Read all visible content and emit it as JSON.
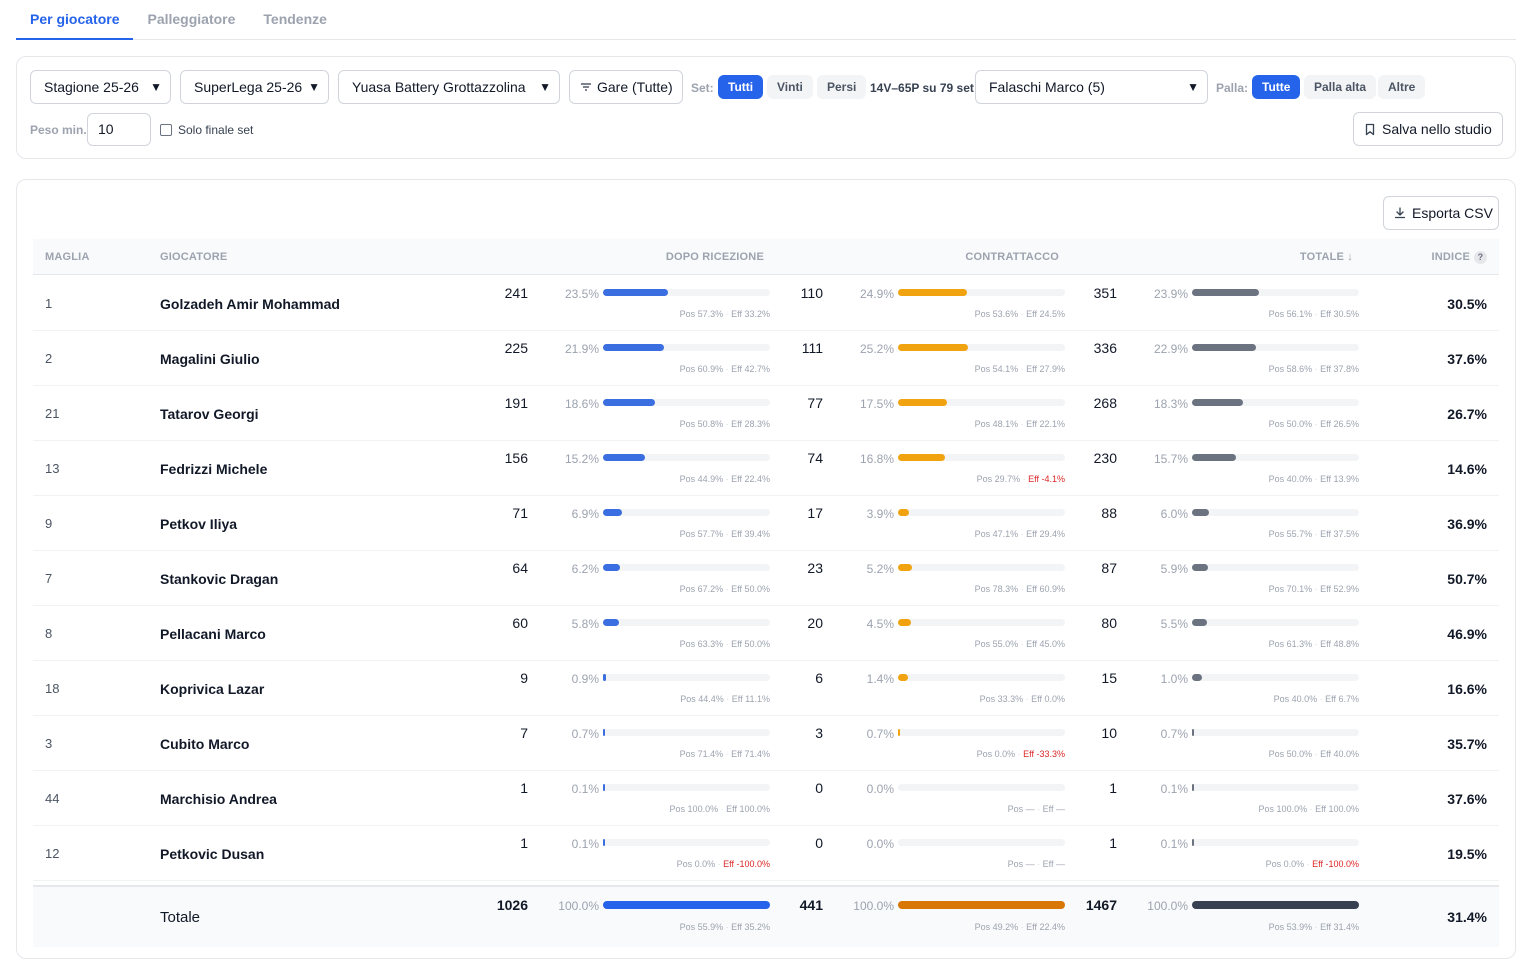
{
  "tabs": [
    {
      "label": "Per giocatore",
      "active": true
    },
    {
      "label": "Palleggiatore",
      "active": false
    },
    {
      "label": "Tendenze",
      "active": false
    }
  ],
  "filters": {
    "season": "Stagione 25-26",
    "league": "SuperLega 25-26",
    "team": "Yuasa Battery Grottazzolina",
    "matches": "Gare (Tutte)",
    "set_label": "Set:",
    "set_options": [
      {
        "label": "Tutti",
        "active": true
      },
      {
        "label": "Vinti",
        "active": false
      },
      {
        "label": "Persi",
        "active": false
      }
    ],
    "set_summary": "14V–65P su 79 set",
    "setter": "Falaschi Marco (5)",
    "ball_label": "Palla:",
    "ball_options": [
      {
        "label": "Tutte",
        "active": true
      },
      {
        "label": "Palla alta",
        "active": false
      },
      {
        "label": "Altre",
        "active": false
      }
    ],
    "min_weight_label": "Peso min.",
    "min_weight_value": "10",
    "final_set_label": "Solo finale set",
    "final_set_checked": false,
    "save_label": "Salva nello studio"
  },
  "export_label": "Esporta CSV",
  "table": {
    "headers": {
      "jersey": "MAGLIA",
      "player": "GIOCATORE",
      "reception": "DOPO RICEZIONE",
      "counter": "CONTRATTACCO",
      "total": "TOTALE ↓",
      "index": "INDICE",
      "index_help": "?"
    },
    "colors": {
      "reception": "#3b6ee0",
      "counter": "#f0a30f",
      "total": "#6b7280",
      "reception_total": "#2563eb",
      "counter_total": "#d97706",
      "total_total": "#374151"
    },
    "rows": [
      {
        "jersey": "1",
        "name": "Golzadeh Amir Mohammad",
        "rec": {
          "n": "241",
          "pct": "23.5%",
          "v": 23.5,
          "pos": "Pos 57.3%",
          "eff": "Eff 33.2%"
        },
        "cnt": {
          "n": "110",
          "pct": "24.9%",
          "v": 24.9,
          "pos": "Pos 53.6%",
          "eff": "Eff 24.5%"
        },
        "tot": {
          "n": "351",
          "pct": "23.9%",
          "v": 23.9,
          "pos": "Pos 56.1%",
          "eff": "Eff 30.5%"
        },
        "index": "30.5%"
      },
      {
        "jersey": "2",
        "name": "Magalini Giulio",
        "rec": {
          "n": "225",
          "pct": "21.9%",
          "v": 21.9,
          "pos": "Pos 60.9%",
          "eff": "Eff 42.7%"
        },
        "cnt": {
          "n": "111",
          "pct": "25.2%",
          "v": 25.2,
          "pos": "Pos 54.1%",
          "eff": "Eff 27.9%"
        },
        "tot": {
          "n": "336",
          "pct": "22.9%",
          "v": 22.9,
          "pos": "Pos 58.6%",
          "eff": "Eff 37.8%"
        },
        "index": "37.6%"
      },
      {
        "jersey": "21",
        "name": "Tatarov Georgi",
        "rec": {
          "n": "191",
          "pct": "18.6%",
          "v": 18.6,
          "pos": "Pos 50.8%",
          "eff": "Eff 28.3%"
        },
        "cnt": {
          "n": "77",
          "pct": "17.5%",
          "v": 17.5,
          "pos": "Pos 48.1%",
          "eff": "Eff 22.1%"
        },
        "tot": {
          "n": "268",
          "pct": "18.3%",
          "v": 18.3,
          "pos": "Pos 50.0%",
          "eff": "Eff 26.5%"
        },
        "index": "26.7%"
      },
      {
        "jersey": "13",
        "name": "Fedrizzi Michele",
        "rec": {
          "n": "156",
          "pct": "15.2%",
          "v": 15.2,
          "pos": "Pos 44.9%",
          "eff": "Eff 22.4%"
        },
        "cnt": {
          "n": "74",
          "pct": "16.8%",
          "v": 16.8,
          "pos": "Pos 29.7%",
          "eff": "Eff -4.1%",
          "neg": true
        },
        "tot": {
          "n": "230",
          "pct": "15.7%",
          "v": 15.7,
          "pos": "Pos 40.0%",
          "eff": "Eff 13.9%"
        },
        "index": "14.6%"
      },
      {
        "jersey": "9",
        "name": "Petkov Iliya",
        "rec": {
          "n": "71",
          "pct": "6.9%",
          "v": 6.9,
          "pos": "Pos 57.7%",
          "eff": "Eff 39.4%"
        },
        "cnt": {
          "n": "17",
          "pct": "3.9%",
          "v": 3.9,
          "pos": "Pos 47.1%",
          "eff": "Eff 29.4%"
        },
        "tot": {
          "n": "88",
          "pct": "6.0%",
          "v": 6.0,
          "pos": "Pos 55.7%",
          "eff": "Eff 37.5%"
        },
        "index": "36.9%"
      },
      {
        "jersey": "7",
        "name": "Stankovic Dragan",
        "rec": {
          "n": "64",
          "pct": "6.2%",
          "v": 6.2,
          "pos": "Pos 67.2%",
          "eff": "Eff 50.0%"
        },
        "cnt": {
          "n": "23",
          "pct": "5.2%",
          "v": 5.2,
          "pos": "Pos 78.3%",
          "eff": "Eff 60.9%"
        },
        "tot": {
          "n": "87",
          "pct": "5.9%",
          "v": 5.9,
          "pos": "Pos 70.1%",
          "eff": "Eff 52.9%"
        },
        "index": "50.7%"
      },
      {
        "jersey": "8",
        "name": "Pellacani Marco",
        "rec": {
          "n": "60",
          "pct": "5.8%",
          "v": 5.8,
          "pos": "Pos 63.3%",
          "eff": "Eff 50.0%"
        },
        "cnt": {
          "n": "20",
          "pct": "4.5%",
          "v": 4.5,
          "pos": "Pos 55.0%",
          "eff": "Eff 45.0%"
        },
        "tot": {
          "n": "80",
          "pct": "5.5%",
          "v": 5.5,
          "pos": "Pos 61.3%",
          "eff": "Eff 48.8%"
        },
        "index": "46.9%"
      },
      {
        "jersey": "18",
        "name": "Koprivica Lazar",
        "rec": {
          "n": "9",
          "pct": "0.9%",
          "v": 0.9,
          "pos": "Pos 44.4%",
          "eff": "Eff 11.1%"
        },
        "cnt": {
          "n": "6",
          "pct": "1.4%",
          "v": 1.4,
          "pos": "Pos 33.3%",
          "eff": "Eff 0.0%"
        },
        "tot": {
          "n": "15",
          "pct": "1.0%",
          "v": 1.0,
          "pos": "Pos 40.0%",
          "eff": "Eff 6.7%"
        },
        "index": "16.6%"
      },
      {
        "jersey": "3",
        "name": "Cubito Marco",
        "rec": {
          "n": "7",
          "pct": "0.7%",
          "v": 0.7,
          "pos": "Pos 71.4%",
          "eff": "Eff 71.4%"
        },
        "cnt": {
          "n": "3",
          "pct": "0.7%",
          "v": 0.7,
          "pos": "Pos 0.0%",
          "eff": "Eff -33.3%",
          "neg": true
        },
        "tot": {
          "n": "10",
          "pct": "0.7%",
          "v": 0.7,
          "pos": "Pos 50.0%",
          "eff": "Eff 40.0%"
        },
        "index": "35.7%"
      },
      {
        "jersey": "44",
        "name": "Marchisio Andrea",
        "rec": {
          "n": "1",
          "pct": "0.1%",
          "v": 0.1,
          "pos": "Pos 100.0%",
          "eff": "Eff 100.0%"
        },
        "cnt": {
          "n": "0",
          "pct": "0.0%",
          "v": 0,
          "pos": "Pos —",
          "eff": "Eff —"
        },
        "tot": {
          "n": "1",
          "pct": "0.1%",
          "v": 0.1,
          "pos": "Pos 100.0%",
          "eff": "Eff 100.0%"
        },
        "index": "37.6%"
      },
      {
        "jersey": "12",
        "name": "Petkovic Dusan",
        "rec": {
          "n": "1",
          "pct": "0.1%",
          "v": 0.1,
          "pos": "Pos 0.0%",
          "eff": "Eff -100.0%",
          "neg": true
        },
        "cnt": {
          "n": "0",
          "pct": "0.0%",
          "v": 0,
          "pos": "Pos —",
          "eff": "Eff —"
        },
        "tot": {
          "n": "1",
          "pct": "0.1%",
          "v": 0.1,
          "pos": "Pos 0.0%",
          "eff": "Eff -100.0%",
          "neg": true
        },
        "index": "19.5%"
      }
    ],
    "total": {
      "name": "Totale",
      "rec": {
        "n": "1026",
        "pct": "100.0%",
        "v": 100,
        "pos": "Pos 55.9%",
        "eff": "Eff 35.2%"
      },
      "cnt": {
        "n": "441",
        "pct": "100.0%",
        "v": 100,
        "pos": "Pos 49.2%",
        "eff": "Eff 22.4%"
      },
      "tot": {
        "n": "1467",
        "pct": "100.0%",
        "v": 100,
        "pos": "Pos 53.9%",
        "eff": "Eff 31.4%"
      },
      "index": "31.4%"
    }
  }
}
